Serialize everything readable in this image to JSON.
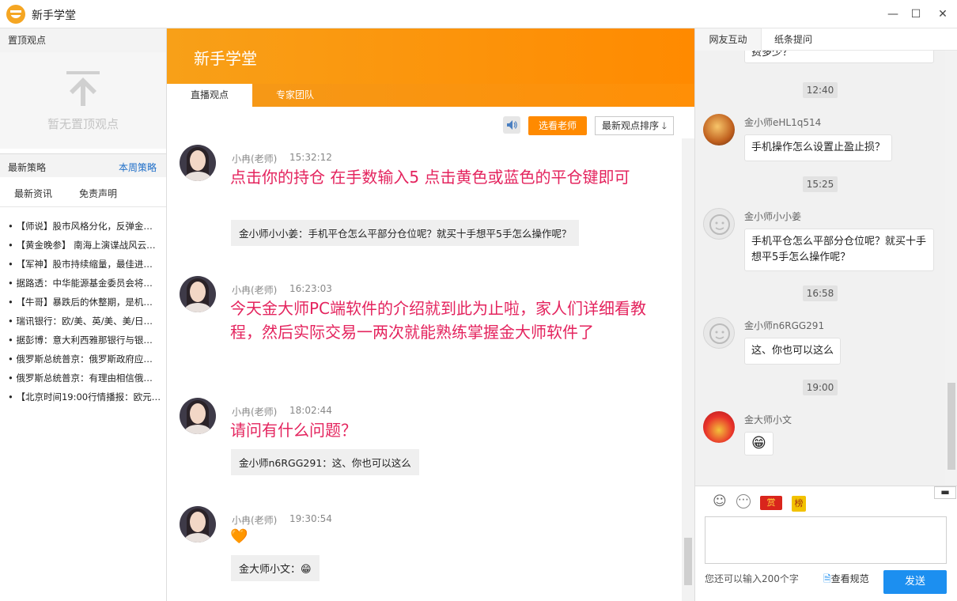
{
  "window": {
    "title": "新手学堂",
    "minimize": "—",
    "maximize": "☐",
    "close": "✕"
  },
  "left": {
    "pinned_header": "置顶观点",
    "pinned_empty": "暂无置顶观点",
    "strategy_header": "最新策略",
    "strategy_link": "本周策略",
    "tabs": [
      "最新资讯",
      "免责声明"
    ],
    "news": [
      "• 【师说】股市风格分化，反弹金…",
      "• 【黄金晚参】 南海上演谍战风云…",
      "• 【军神】股市持续缩量，最佳进…",
      "• 据路透：中华能源基金委员会将…",
      "• 【牛哥】暴跌后的休整期，是机…",
      "• 瑞讯银行：欧/美、英/美、美/日…",
      "• 据彭博：意大利西雅那银行与银…",
      "• 俄罗斯总统普京：俄罗斯政府应…",
      "• 俄罗斯总统普京：有理由相信俄…",
      "• 【北京时间19:00行情播报：欧元…"
    ]
  },
  "center": {
    "banner_title": "新手学堂",
    "tabs": [
      "直播观点",
      "专家团队"
    ],
    "select_teacher": "选看老师",
    "sort_label": "最新观点排序 🡓",
    "posts": [
      {
        "name": "小冉(老师)",
        "time": "15:32:12",
        "message": "点击你的持仓  在手数输入5    点击黄色或蓝色的平仓键即可",
        "quote": "金小师小小姜：手机平仓怎么平部分仓位呢？就买十手想平5手怎么操作呢？"
      },
      {
        "name": "小冉(老师)",
        "time": "16:23:03",
        "message": "今天金大师PC端软件的介绍就到此为止啦，家人们详细看教程，然后实际交易一两次就能熟练掌握金大师软件了",
        "quote": ""
      },
      {
        "name": "小冉(老师)",
        "time": "18:02:44",
        "message": "请问有什么问题？",
        "quote": "金小师n6RGG291：这、你也可以这么"
      },
      {
        "name": "小冉(老师)",
        "time": "19:30:54",
        "message": "🧡",
        "quote": "金大师小文：😁"
      }
    ]
  },
  "right": {
    "tabs": [
      "网友互动",
      "纸条提问"
    ],
    "partial_bubble": "费多少？",
    "messages": [
      {
        "time": "12:40",
        "name": "金小师eHL1q514",
        "text": "手机操作怎么设置止盈止损？"
      },
      {
        "time": "15:25",
        "name": "金小师小小姜",
        "text": "手机平仓怎么平部分仓位呢？就买十手想平5手怎么操作呢？"
      },
      {
        "time": "16:58",
        "name": "金小师n6RGG291",
        "text": "这、你也可以这么"
      },
      {
        "time": "19:00",
        "name": "金大师小文",
        "text": "😁"
      }
    ],
    "emoji_icons": [
      "☺",
      "⋯"
    ],
    "reward_label": "赏",
    "rank_label": "榜",
    "char_hint": "您还可以输入200个字",
    "rules_link": "查看规范",
    "send": "发送"
  }
}
